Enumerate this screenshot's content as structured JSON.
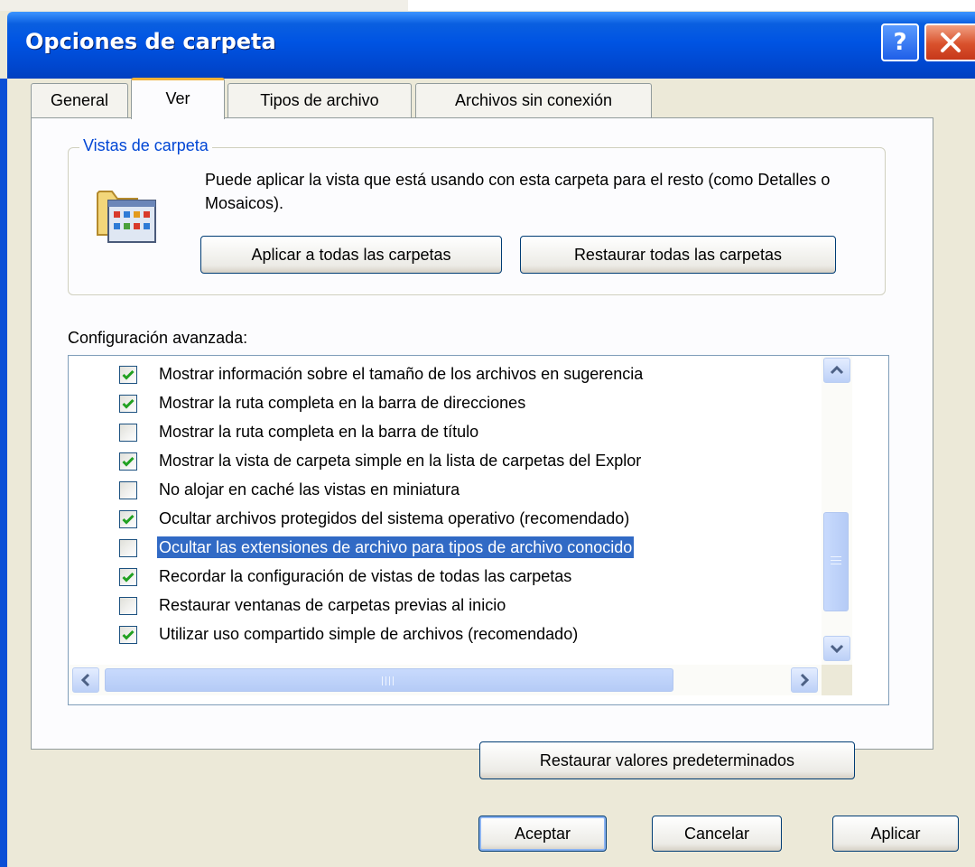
{
  "window": {
    "title": "Opciones de carpeta",
    "help_label": "?",
    "colors": {
      "titlebar": "#0054e3",
      "selection": "#316ac5",
      "group_label": "#0046d5"
    }
  },
  "tabs": [
    {
      "label": "General",
      "active": false
    },
    {
      "label": "Ver",
      "active": true
    },
    {
      "label": "Tipos de archivo",
      "active": false
    },
    {
      "label": "Archivos sin conexión",
      "active": false
    }
  ],
  "folder_views": {
    "group_label": "Vistas de carpeta",
    "description": "Puede aplicar la vista que está usando con esta carpeta para el resto (como Detalles o Mosaicos).",
    "icon": "folder-views-icon",
    "apply_all_label": "Aplicar a todas las carpetas",
    "restore_all_label": "Restaurar todas las carpetas"
  },
  "advanced": {
    "label": "Configuración avanzada:",
    "items": [
      {
        "label": "Mostrar información sobre el tamaño de los archivos en sugerencia",
        "checked": true,
        "selected": false
      },
      {
        "label": "Mostrar la ruta completa en la barra de direcciones",
        "checked": true,
        "selected": false
      },
      {
        "label": "Mostrar la ruta completa en la barra de título",
        "checked": false,
        "selected": false
      },
      {
        "label": "Mostrar la vista de carpeta simple en la lista de carpetas del Explor",
        "checked": true,
        "selected": false
      },
      {
        "label": "No alojar en caché las vistas en miniatura",
        "checked": false,
        "selected": false
      },
      {
        "label": "Ocultar archivos protegidos del sistema operativo (recomendado)",
        "checked": true,
        "selected": false
      },
      {
        "label": "Ocultar las extensiones de archivo para tipos de archivo conocido",
        "checked": false,
        "selected": true
      },
      {
        "label": "Recordar la configuración de vistas de todas las carpetas",
        "checked": true,
        "selected": false
      },
      {
        "label": "Restaurar ventanas de carpetas previas al inicio",
        "checked": false,
        "selected": false
      },
      {
        "label": "Utilizar uso compartido simple de archivos (recomendado)",
        "checked": true,
        "selected": false
      }
    ],
    "vertical_scroll_position": 0.85
  },
  "restore_defaults_label": "Restaurar valores predeterminados",
  "footer": {
    "ok_label": "Aceptar",
    "cancel_label": "Cancelar",
    "apply_label": "Aplicar"
  }
}
